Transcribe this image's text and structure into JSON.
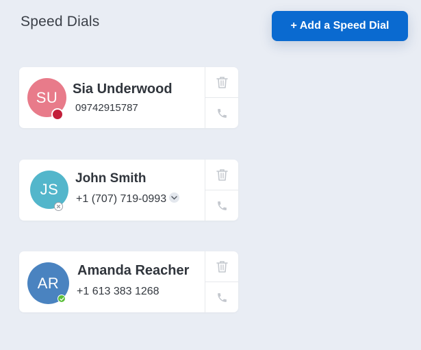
{
  "header": {
    "title": "Speed Dials",
    "add_button_label": "+ Add a Speed Dial"
  },
  "colors": {
    "accent": "#0a6ad0",
    "background": "#e9edf4"
  },
  "contacts": [
    {
      "initials": "SU",
      "name": "Sia Underwood",
      "phone": "09742915787",
      "avatar_color": "#e87b8a",
      "status": "busy",
      "status_color": "#c21f3a"
    },
    {
      "initials": "JS",
      "name": "John Smith",
      "phone": "+1 (707) 719-0993",
      "avatar_color": "#53b6cb",
      "status": "offline",
      "status_color": "#9aa0a8",
      "has_number_dropdown": true
    },
    {
      "initials": "AR",
      "name": "Amanda Reacher",
      "phone": "+1 613 383 1268",
      "avatar_color": "#4a83c0",
      "status": "available",
      "status_color": "#5bbf3a"
    }
  ],
  "icons": {
    "delete": "trash-icon",
    "call": "phone-icon"
  }
}
